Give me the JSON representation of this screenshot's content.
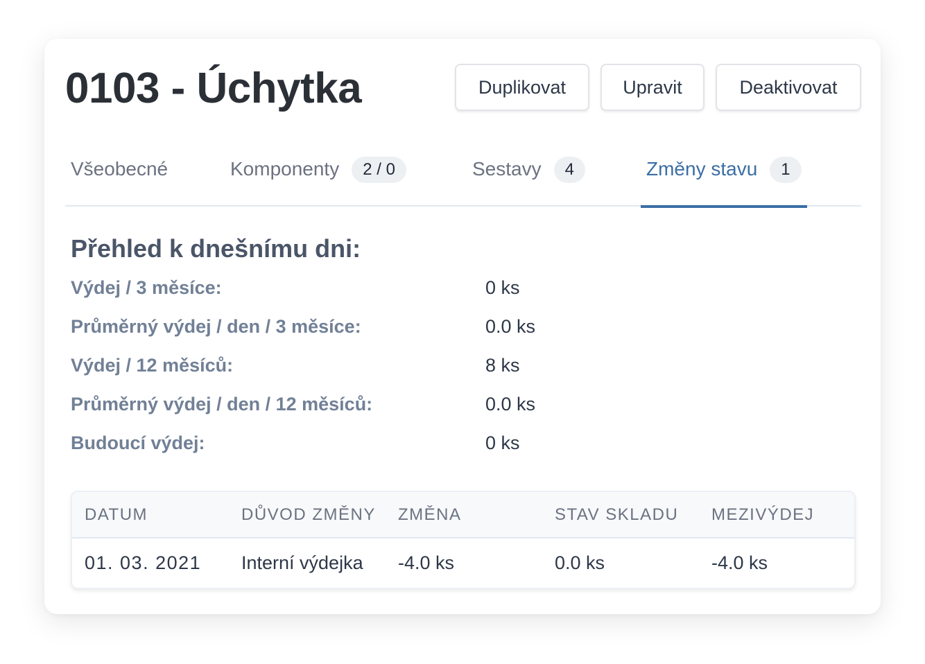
{
  "header": {
    "title": "0103 - Úchytka",
    "buttons": {
      "duplicate": "Duplikovat",
      "edit": "Upravit",
      "deactivate": "Deaktivovat"
    }
  },
  "tabs": [
    {
      "label": "Všeobecné",
      "badge": null,
      "active": false
    },
    {
      "label": "Komponenty",
      "badge": "2 / 0",
      "active": false
    },
    {
      "label": "Sestavy",
      "badge": "4",
      "active": false
    },
    {
      "label": "Změny stavu",
      "badge": "1",
      "active": true
    }
  ],
  "overview": {
    "title": "Přehled k dnešnímu dni:",
    "stats": [
      {
        "label": "Výdej / 3 měsíce:",
        "value": "0 ks"
      },
      {
        "label": "Průměrný výdej / den / 3 měsíce:",
        "value": "0.0 ks"
      },
      {
        "label": "Výdej / 12 měsíců:",
        "value": "8 ks"
      },
      {
        "label": "Průměrný výdej / den / 12 měsíců:",
        "value": "0.0 ks"
      },
      {
        "label": "Budoucí výdej:",
        "value": "0 ks"
      }
    ]
  },
  "table": {
    "columns": [
      "DATUM",
      "DŮVOD ZMĚNY",
      "ZMĚNA",
      "STAV SKLADU",
      "MEZIVÝDEJ"
    ],
    "rows": [
      [
        "01. 03. 2021",
        "Interní výdejka",
        "-4.0 ks",
        "0.0 ks",
        "-4.0 ks"
      ]
    ]
  },
  "colors": {
    "active_tab": "#3b6ea5",
    "badge_bg": "#edf0f3"
  }
}
